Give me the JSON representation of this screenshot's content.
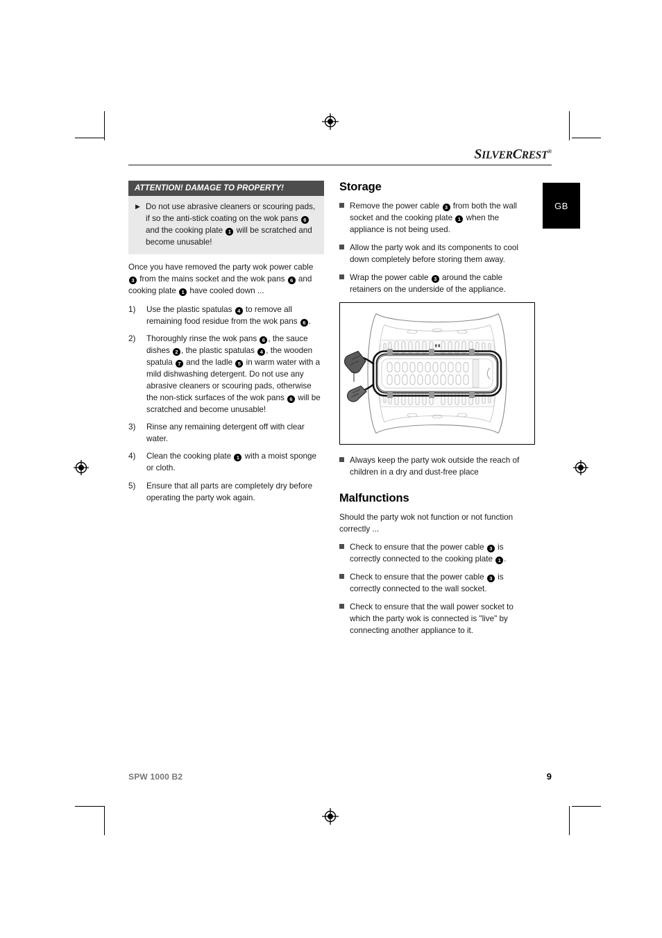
{
  "brand": {
    "name_part1": "S",
    "name_part2": "ILVER",
    "name_part3": "C",
    "name_part4": "REST",
    "trademark": "®"
  },
  "language_tab": {
    "label": "GB"
  },
  "left_column": {
    "warning_box": {
      "title": "ATTENTION! DAMAGE TO PROPERTY!",
      "arrow_icon": "▶",
      "items": [
        {
          "seg1": "Do not use abrasive cleaners or scouring pads, if so the anti-stick coating on the wok pans ",
          "ref1": "6",
          "seg2": " and the cooking plate ",
          "ref2": "1",
          "seg3": " will be scratched and become unusable!"
        }
      ]
    },
    "intro": {
      "seg1": "Once you have removed the party wok power cable ",
      "ref1": "3",
      "seg2": " from the mains socket and the wok pans ",
      "ref2": "6",
      "seg3": " and cooking plate ",
      "ref3": "1",
      "seg4": " have cooled down ..."
    },
    "steps": [
      {
        "number": "1)",
        "seg1": "Use the plastic spatulas ",
        "ref1": "4",
        "seg2": " to remove all remaining food residue from the wok pans ",
        "ref2": "6",
        "seg3": "."
      },
      {
        "number": "2)",
        "seg1": "Thoroughly rinse the wok pans ",
        "ref1": "6",
        "seg2": ", the sauce dishes ",
        "ref2": "2",
        "seg3": ", the plastic spatulas ",
        "ref3": "4",
        "seg4": ", the wooden spatula ",
        "ref4": "7",
        "seg5": " and the ladle ",
        "ref5": "5",
        "seg6": " in warm water with a mild dishwashing detergent. Do not use any abrasive cleaners or scouring pads, otherwise the non-stick surfaces of the wok pans ",
        "ref6": "6",
        "seg7": " will be scratched and become unusable!"
      },
      {
        "number": "3)",
        "seg1": "Rinse any remaining detergent off with clear water."
      },
      {
        "number": "4)",
        "seg1": "Clean the cooking plate ",
        "ref1": "1",
        "seg2": " with a moist sponge or cloth."
      },
      {
        "number": "5)",
        "seg1": "Ensure that all parts are completely dry before operating the party wok again."
      }
    ]
  },
  "right_column": {
    "storage": {
      "heading": "Storage",
      "items": [
        {
          "seg1": "Remove the power cable ",
          "ref1": "3",
          "seg2": " from both the wall socket and the cooking plate ",
          "ref2": "1",
          "seg3": " when the appliance is not being used."
        },
        {
          "seg1": "Allow the party wok and its components to cool down completely before storing them away."
        },
        {
          "seg1": "Wrap the power cable ",
          "ref1": "3",
          "seg2": " around the cable retainers on the underside of the appliance."
        }
      ],
      "figure_caption": "appliance-underside-cable-wrap-diagram",
      "after_figure_items": [
        {
          "seg1": "Always keep the party wok outside the reach of children in a dry and dust-free place"
        }
      ]
    },
    "malfunctions": {
      "heading": "Malfunctions",
      "intro": "Should the party wok not function or not function correctly ...",
      "items": [
        {
          "seg1": "Check to ensure that the power cable ",
          "ref1": "3",
          "seg2": " is correctly connected to the cooking plate ",
          "ref2": "1",
          "seg3": "."
        },
        {
          "seg1": "Check to ensure that the power cable ",
          "ref1": "3",
          "seg2": " is correctly connected to the wall socket."
        },
        {
          "seg1": "Check to ensure that the wall power socket to which the party wok is connected is \"live\" by connecting another appliance to it."
        }
      ]
    }
  },
  "footer": {
    "model": "SPW 1000 B2",
    "page_number": "9"
  }
}
